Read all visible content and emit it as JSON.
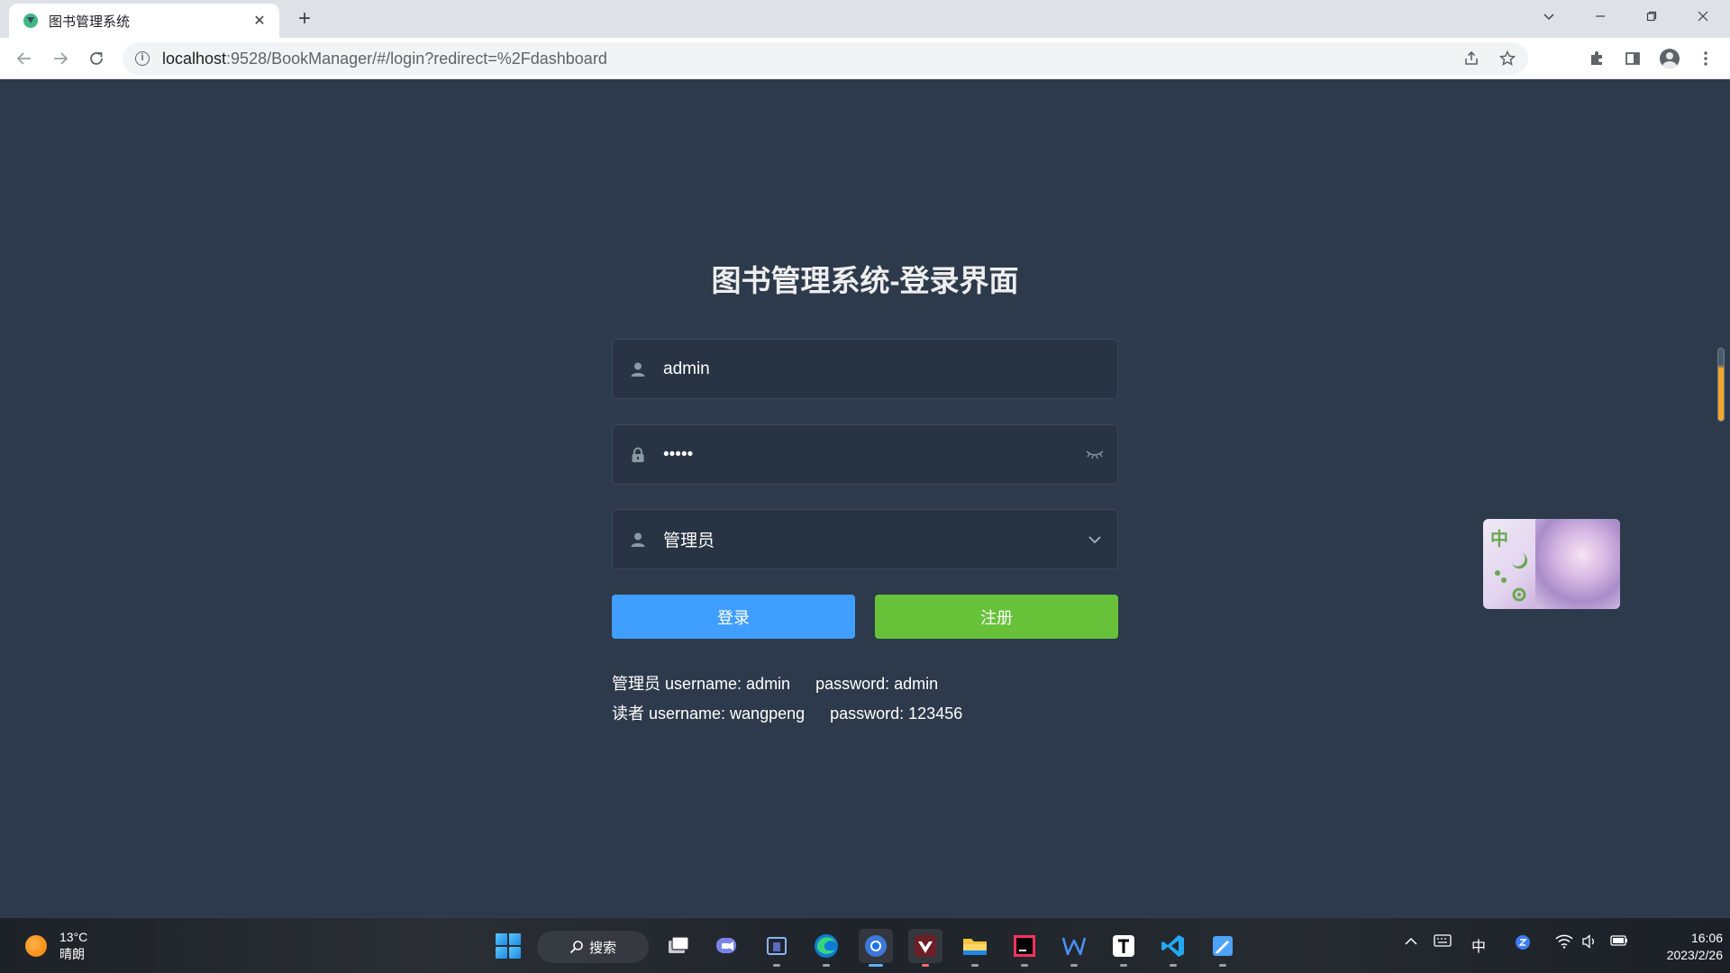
{
  "browser": {
    "tab_title": "图书管理系统",
    "url_host": "localhost",
    "url_rest": ":9528/BookManager/#/login?redirect=%2Fdashboard"
  },
  "login": {
    "title": "图书管理系统-登录界面",
    "username_value": "admin",
    "password_value": "•••••",
    "role_value": "管理员",
    "login_button": "登录",
    "register_button": "注册",
    "hint_admin_user": "管理员 username: admin",
    "hint_admin_pass": "password: admin",
    "hint_reader_user": "读者 username: wangpeng",
    "hint_reader_pass": "password: 123456"
  },
  "widget": {
    "label": "中"
  },
  "taskbar": {
    "temperature": "13°C",
    "weather": "晴朗",
    "search_label": "搜索",
    "ime_label": "中",
    "time": "16:06",
    "date": "2023/2/26"
  },
  "colors": {
    "page_bg": "#2d3a4b",
    "input_bg": "#283443",
    "login_button": "#409eff",
    "register_button": "#67c23a"
  }
}
